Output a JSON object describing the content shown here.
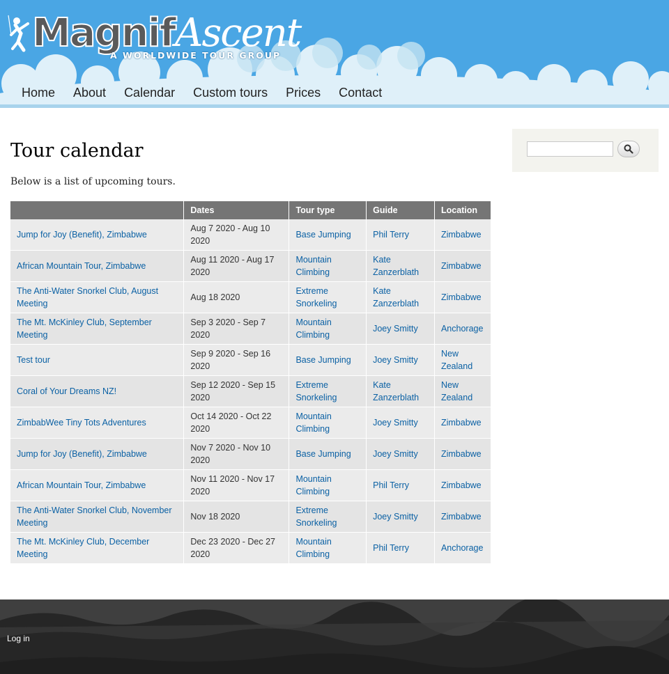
{
  "brand": {
    "logo_main": "MagnifAscent",
    "logo_main_a": "Magnif",
    "logo_main_b": "Ascent",
    "tagline": "A WORLDWIDE TOUR GROUP"
  },
  "nav": {
    "items": [
      {
        "label": "Home"
      },
      {
        "label": "About"
      },
      {
        "label": "Calendar"
      },
      {
        "label": "Custom tours"
      },
      {
        "label": "Prices"
      },
      {
        "label": "Contact"
      }
    ]
  },
  "page": {
    "title": "Tour calendar",
    "intro": "Below is a list of upcoming tours."
  },
  "table": {
    "headers": [
      "",
      "Dates",
      "Tour type",
      "Guide",
      "Location"
    ],
    "rows": [
      {
        "name": "Jump for Joy (Benefit), Zimbabwe",
        "dates": "Aug 7 2020 - Aug 10 2020",
        "type": "Base Jumping",
        "guide": "Phil Terry",
        "location": "Zimbabwe"
      },
      {
        "name": "African Mountain Tour, Zimbabwe",
        "dates": "Aug 11 2020 - Aug 17 2020",
        "type": "Mountain Climbing",
        "guide": "Kate Zanzerblath",
        "location": "Zimbabwe"
      },
      {
        "name": "The Anti-Water Snorkel Club, August Meeting",
        "dates": "Aug 18 2020",
        "type": "Extreme Snorkeling",
        "guide": "Kate Zanzerblath",
        "location": "Zimbabwe"
      },
      {
        "name": "The Mt. McKinley Club, September Meeting",
        "dates": "Sep 3 2020 - Sep 7 2020",
        "type": "Mountain Climbing",
        "guide": "Joey Smitty",
        "location": "Anchorage"
      },
      {
        "name": "Test tour",
        "dates": "Sep 9 2020 - Sep 16 2020",
        "type": "Base Jumping",
        "guide": "Joey Smitty",
        "location": "New Zealand"
      },
      {
        "name": "Coral of Your Dreams NZ!",
        "dates": "Sep 12 2020 - Sep 15 2020",
        "type": "Extreme Snorkeling",
        "guide": "Kate Zanzerblath",
        "location": "New Zealand"
      },
      {
        "name": "ZimbabWee Tiny Tots Adventures",
        "dates": "Oct 14 2020 - Oct 22 2020",
        "type": "Mountain Climbing",
        "guide": "Joey Smitty",
        "location": "Zimbabwe"
      },
      {
        "name": "Jump for Joy (Benefit), Zimbabwe",
        "dates": "Nov 7 2020 - Nov 10 2020",
        "type": "Base Jumping",
        "guide": "Joey Smitty",
        "location": "Zimbabwe"
      },
      {
        "name": "African Mountain Tour, Zimbabwe",
        "dates": "Nov 11 2020 - Nov 17 2020",
        "type": "Mountain Climbing",
        "guide": "Phil Terry",
        "location": "Zimbabwe"
      },
      {
        "name": "The Anti-Water Snorkel Club, November Meeting",
        "dates": "Nov 18 2020",
        "type": "Extreme Snorkeling",
        "guide": "Joey Smitty",
        "location": "Zimbabwe"
      },
      {
        "name": "The Mt. McKinley Club, December Meeting",
        "dates": "Dec 23 2020 - Dec 27 2020",
        "type": "Mountain Climbing",
        "guide": "Phil Terry",
        "location": "Anchorage"
      }
    ]
  },
  "search": {
    "value": "",
    "icon": "search-icon"
  },
  "footer": {
    "login": "Log in"
  },
  "colors": {
    "header": "#4aa6e4",
    "link": "#0b61a4",
    "table_header": "#757575",
    "footer": "#2b2b2b"
  }
}
